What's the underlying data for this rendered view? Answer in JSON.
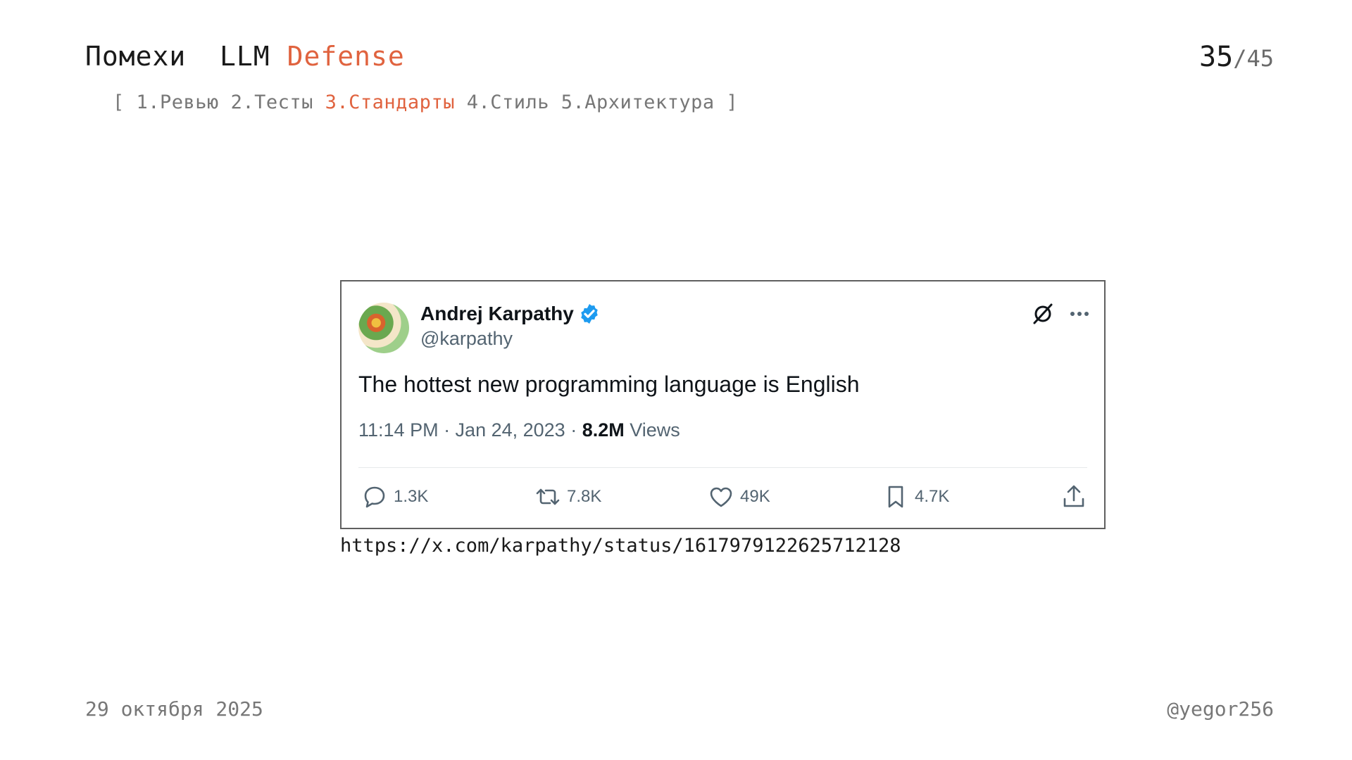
{
  "header": {
    "title_part1": "Помехи  LLM",
    "title_accent": "Defense",
    "page_current": "35",
    "page_total": "/45"
  },
  "nav": {
    "open_bracket": "[ ",
    "items": [
      "1.Ревью",
      "2.Тесты",
      "3.Стандарты",
      "4.Стиль",
      "5.Архитектура"
    ],
    "active_index": 2,
    "close_bracket": " ]"
  },
  "tweet": {
    "author_name": "Andrej Karpathy",
    "handle": "@karpathy",
    "verified": true,
    "text": "The hottest new programming language is English",
    "time": "11:14 PM · Jan 24, 2023 · ",
    "views_count": "8.2M",
    "views_label": " Views",
    "replies": "1.3K",
    "reposts": "7.8K",
    "likes": "49K",
    "bookmarks": "4.7K",
    "icons": {
      "verified": "verified-badge-icon",
      "grok": "grok-icon",
      "more": "more-icon",
      "reply": "reply-icon",
      "repost": "repost-icon",
      "like": "heart-icon",
      "bookmark": "bookmark-icon",
      "share": "share-icon"
    },
    "colors": {
      "verified": "#1d9bf0",
      "secondary_text": "#536471",
      "primary_text": "#0f1419"
    }
  },
  "url_caption": "https://x.com/karpathy/status/1617979122625712128",
  "footer": {
    "date": "29 октября 2025",
    "handle": "@yegor256"
  },
  "colors": {
    "accent": "#e0633f",
    "muted": "#777777"
  }
}
